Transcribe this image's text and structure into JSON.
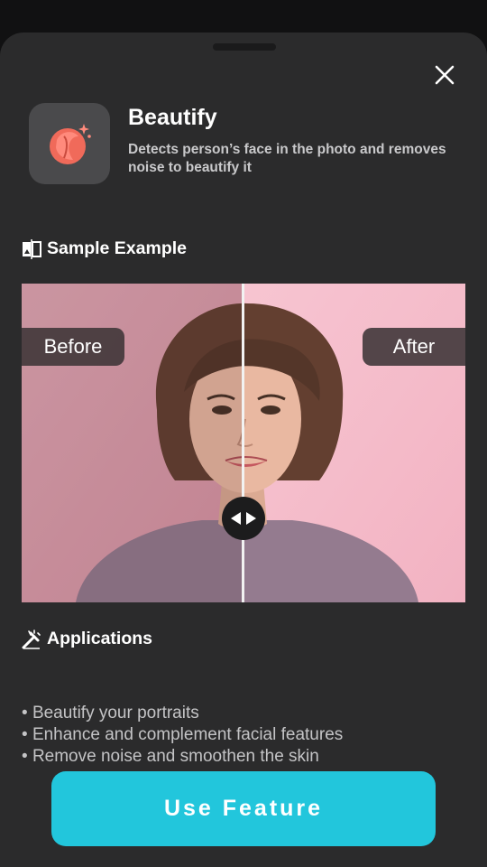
{
  "feature": {
    "title": "Beautify",
    "description": "Detects person’s face in the photo and removes noise to beautify it",
    "icon": "face-sparkle-icon",
    "accent": "#f06a5a"
  },
  "sample": {
    "heading": "Sample Example",
    "before_label": "Before",
    "after_label": "After"
  },
  "applications": {
    "heading": "Applications",
    "items": [
      "Beautify your portraits",
      "Enhance and complement facial features",
      "Remove noise and smoothen the skin"
    ]
  },
  "cta": {
    "label": "Use Feature",
    "color": "#22c6dc"
  }
}
